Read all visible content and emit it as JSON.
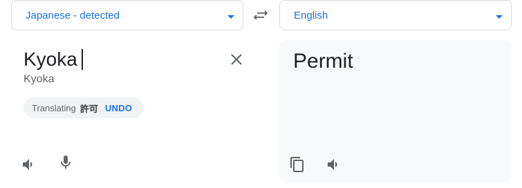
{
  "source_lang": {
    "label": "Japanese - detected"
  },
  "target_lang": {
    "label": "English"
  },
  "source": {
    "text": "Kyoka",
    "transliteration": "Kyoka",
    "chip": {
      "label": "Translating",
      "term": "許可",
      "undo": "UNDO"
    }
  },
  "target": {
    "text": "Permit"
  },
  "colors": {
    "accent": "#1a73e8",
    "panel_bg": "#f8f9fa",
    "chip_bg": "#f1f3f4",
    "icon": "#5f6368"
  },
  "icons": [
    "chevron-down-icon",
    "swap-languages-icon",
    "close-icon",
    "speaker-icon",
    "microphone-icon",
    "copy-icon"
  ]
}
